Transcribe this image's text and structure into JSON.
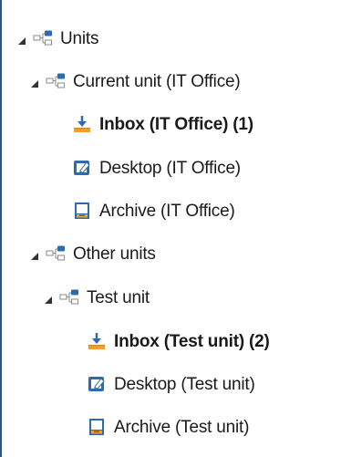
{
  "tree": {
    "units": {
      "label": "Units",
      "icon": "org-chart-icon",
      "expanded": true
    },
    "current_unit": {
      "label": "Current unit (IT Office)",
      "icon": "org-chart-icon",
      "expanded": true,
      "children": {
        "inbox": {
          "label": "Inbox (IT Office) (1)",
          "icon": "inbox-download-icon",
          "bold": true
        },
        "desktop": {
          "label": "Desktop (IT Office)",
          "icon": "desktop-edit-icon"
        },
        "archive": {
          "label": "Archive (IT Office)",
          "icon": "archive-icon"
        }
      }
    },
    "other_units": {
      "label": "Other units",
      "icon": "org-chart-icon",
      "expanded": true
    },
    "test_unit": {
      "label": "Test unit",
      "icon": "org-chart-icon",
      "expanded": true,
      "children": {
        "inbox": {
          "label": "Inbox (Test unit) (2)",
          "icon": "inbox-download-icon",
          "bold": true
        },
        "desktop": {
          "label": "Desktop (Test unit)",
          "icon": "desktop-edit-icon"
        },
        "archive": {
          "label": "Archive (Test unit)",
          "icon": "archive-icon"
        }
      }
    }
  },
  "colors": {
    "accent_blue": "#2b6cb0",
    "inbox_orange": "#f0a030",
    "expander": "#333333"
  }
}
